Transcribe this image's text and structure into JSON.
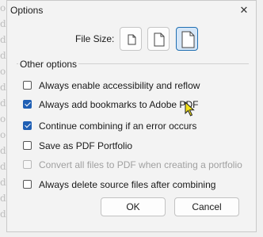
{
  "background_text": "oo\nd\nd\nd\no\nd\nd\no\noc\nd\nd\nd\nd\nd",
  "dialog": {
    "title": "Options",
    "close_glyph": "✕"
  },
  "file_size": {
    "label": "File Size:",
    "options": [
      "small",
      "medium",
      "large"
    ],
    "selected": "large"
  },
  "other_options": {
    "label": "Other options",
    "items": [
      {
        "label": "Always enable accessibility and reflow",
        "checked": false,
        "enabled": true
      },
      {
        "label": "Always add bookmarks to Adobe PDF",
        "checked": true,
        "enabled": true
      },
      {
        "label": "Continue combining if an error occurs",
        "checked": true,
        "enabled": true
      },
      {
        "label": "Save as PDF Portfolio",
        "checked": false,
        "enabled": true
      },
      {
        "label": "Convert all files to PDF when creating a portfolio",
        "checked": false,
        "enabled": false
      },
      {
        "label": "Always delete source files after combining",
        "checked": false,
        "enabled": true
      }
    ]
  },
  "buttons": {
    "ok": "OK",
    "cancel": "Cancel"
  },
  "colors": {
    "accent": "#1f5fb4",
    "selected_fill": "#d5e6f7"
  }
}
